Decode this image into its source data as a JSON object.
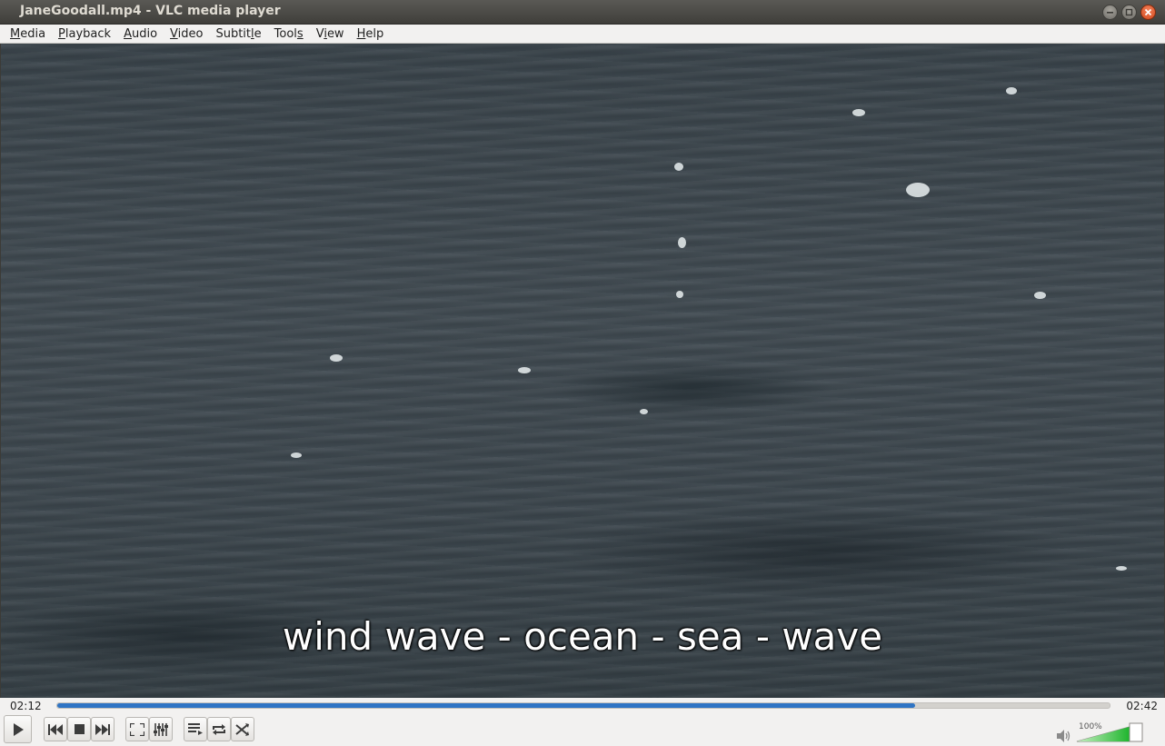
{
  "window": {
    "title": "JaneGoodall.mp4 - VLC media player"
  },
  "menu": [
    {
      "underline": "M",
      "rest": "edia"
    },
    {
      "underline": "P",
      "rest": "layback"
    },
    {
      "underline": "A",
      "rest": "udio"
    },
    {
      "underline": "V",
      "rest": "ideo"
    },
    {
      "underline": "",
      "pre": "Subtit",
      "underline2": "l",
      "rest": "e"
    },
    {
      "underline": "",
      "pre": "Tool",
      "underline2": "s",
      "rest": ""
    },
    {
      "underline": "",
      "pre": "V",
      "underline2": "i",
      "rest": "ew"
    },
    {
      "underline": "H",
      "rest": "elp"
    }
  ],
  "video": {
    "subtitle": "wind wave - ocean - sea - wave"
  },
  "playback": {
    "elapsed": "02:12",
    "total": "02:42",
    "progress_fraction": 0.815
  },
  "volume": {
    "label": "100%",
    "level_fraction": 1.0
  },
  "colors": {
    "seek_fill": "#2f74c4",
    "volume_fill": "#2cc23a",
    "close_button": "#e0562a"
  },
  "icons": [
    "minimize-icon",
    "maximize-icon",
    "close-icon",
    "play-icon",
    "previous-icon",
    "stop-icon",
    "next-icon",
    "fullscreen-icon",
    "extended-settings-icon",
    "playlist-icon",
    "loop-icon",
    "shuffle-icon",
    "speaker-icon"
  ]
}
